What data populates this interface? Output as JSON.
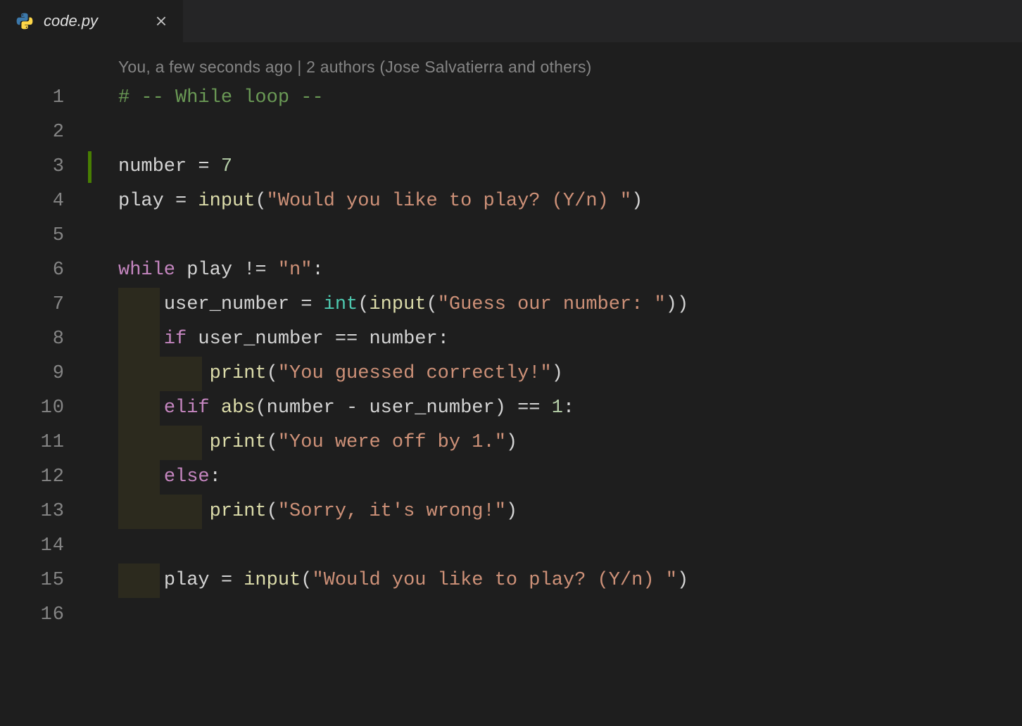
{
  "tab": {
    "filename": "code.py",
    "close_title": "Close"
  },
  "codelens": {
    "text": "You, a few seconds ago | 2 authors (Jose Salvatierra and others)"
  },
  "charWidth": 14.85,
  "lines": [
    {
      "n": "1",
      "git": false,
      "indent": 0,
      "tokens": [
        [
          "comment",
          "# -- While loop --"
        ]
      ]
    },
    {
      "n": "2",
      "git": false,
      "indent": 0,
      "tokens": []
    },
    {
      "n": "3",
      "git": true,
      "indent": 0,
      "tokens": [
        [
          "var",
          "number"
        ],
        [
          "op",
          " = "
        ],
        [
          "num",
          "7"
        ]
      ]
    },
    {
      "n": "4",
      "git": false,
      "indent": 0,
      "tokens": [
        [
          "var",
          "play"
        ],
        [
          "op",
          " = "
        ],
        [
          "func",
          "input"
        ],
        [
          "punct",
          "("
        ],
        [
          "str",
          "\"Would you like to play? (Y/n) \""
        ],
        [
          "punct",
          ")"
        ]
      ]
    },
    {
      "n": "5",
      "git": false,
      "indent": 0,
      "tokens": []
    },
    {
      "n": "6",
      "git": false,
      "indent": 0,
      "tokens": [
        [
          "kw",
          "while"
        ],
        [
          "var",
          " play "
        ],
        [
          "op",
          "!="
        ],
        [
          "str",
          " \"n\""
        ],
        [
          "punct",
          ":"
        ]
      ]
    },
    {
      "n": "7",
      "git": false,
      "indent": 1,
      "tokens": [
        [
          "var",
          "user_number"
        ],
        [
          "op",
          " = "
        ],
        [
          "builtin",
          "int"
        ],
        [
          "punct",
          "("
        ],
        [
          "func",
          "input"
        ],
        [
          "punct",
          "("
        ],
        [
          "str",
          "\"Guess our number: \""
        ],
        [
          "punct",
          "))"
        ]
      ]
    },
    {
      "n": "8",
      "git": false,
      "indent": 1,
      "tokens": [
        [
          "kw",
          "if"
        ],
        [
          "var",
          " user_number "
        ],
        [
          "op",
          "=="
        ],
        [
          "var",
          " number"
        ],
        [
          "punct",
          ":"
        ]
      ]
    },
    {
      "n": "9",
      "git": false,
      "indent": 2,
      "tokens": [
        [
          "func",
          "print"
        ],
        [
          "punct",
          "("
        ],
        [
          "str",
          "\"You guessed correctly!\""
        ],
        [
          "punct",
          ")"
        ]
      ]
    },
    {
      "n": "10",
      "git": false,
      "indent": 1,
      "tokens": [
        [
          "kw",
          "elif"
        ],
        [
          "var",
          " "
        ],
        [
          "func",
          "abs"
        ],
        [
          "punct",
          "("
        ],
        [
          "var",
          "number"
        ],
        [
          "op",
          " - "
        ],
        [
          "var",
          "user_number"
        ],
        [
          "punct",
          ")"
        ],
        [
          "op",
          " == "
        ],
        [
          "num",
          "1"
        ],
        [
          "punct",
          ":"
        ]
      ]
    },
    {
      "n": "11",
      "git": false,
      "indent": 2,
      "tokens": [
        [
          "func",
          "print"
        ],
        [
          "punct",
          "("
        ],
        [
          "str",
          "\"You were off by 1.\""
        ],
        [
          "punct",
          ")"
        ]
      ]
    },
    {
      "n": "12",
      "git": false,
      "indent": 1,
      "tokens": [
        [
          "kw",
          "else"
        ],
        [
          "punct",
          ":"
        ]
      ]
    },
    {
      "n": "13",
      "git": false,
      "indent": 2,
      "tokens": [
        [
          "func",
          "print"
        ],
        [
          "punct",
          "("
        ],
        [
          "str",
          "\"Sorry, it's wrong!\""
        ],
        [
          "punct",
          ")"
        ]
      ]
    },
    {
      "n": "14",
      "git": false,
      "indent": 0,
      "tokens": []
    },
    {
      "n": "15",
      "git": false,
      "indent": 1,
      "tokens": [
        [
          "var",
          "play"
        ],
        [
          "op",
          " = "
        ],
        [
          "func",
          "input"
        ],
        [
          "punct",
          "("
        ],
        [
          "str",
          "\"Would you like to play? (Y/n) \""
        ],
        [
          "punct",
          ")"
        ]
      ]
    },
    {
      "n": "16",
      "git": false,
      "indent": 0,
      "tokens": []
    }
  ]
}
